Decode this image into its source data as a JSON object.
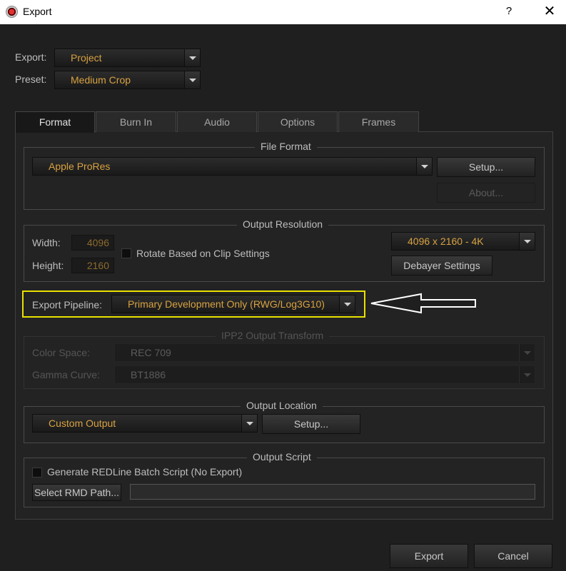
{
  "window": {
    "title": "Export",
    "help": "?",
    "close": "✕"
  },
  "export_row": {
    "label": "Export:",
    "value": "Project"
  },
  "preset_row": {
    "label": "Preset:",
    "value": "Medium Crop"
  },
  "tabs": [
    "Format",
    "Burn In",
    "Audio",
    "Options",
    "Frames"
  ],
  "file_format": {
    "title": "File Format",
    "value": "Apple ProRes",
    "setup": "Setup...",
    "about": "About..."
  },
  "output_resolution": {
    "title": "Output Resolution",
    "width_label": "Width:",
    "width": "4096",
    "height_label": "Height:",
    "height": "2160",
    "rotate_label": "Rotate Based on Clip Settings",
    "preset": "4096 x 2160 - 4K",
    "debayer": "Debayer Settings"
  },
  "pipeline": {
    "label": "Export Pipeline:",
    "value": "Primary Development Only (RWG/Log3G10)"
  },
  "ipp2": {
    "title": "IPP2 Output Transform",
    "color_space_label": "Color Space:",
    "color_space": "REC 709",
    "gamma_label": "Gamma Curve:",
    "gamma": "BT1886"
  },
  "output_location": {
    "title": "Output Location",
    "value": "Custom Output",
    "setup": "Setup..."
  },
  "output_script": {
    "title": "Output Script",
    "generate_label": "Generate REDLine Batch Script (No Export)",
    "rmd_button": "Select RMD Path..."
  },
  "footer": {
    "export": "Export",
    "cancel": "Cancel"
  },
  "colors": {
    "accent": "#d8a242",
    "highlight": "#e8e000",
    "background": "#1f1f1f"
  }
}
